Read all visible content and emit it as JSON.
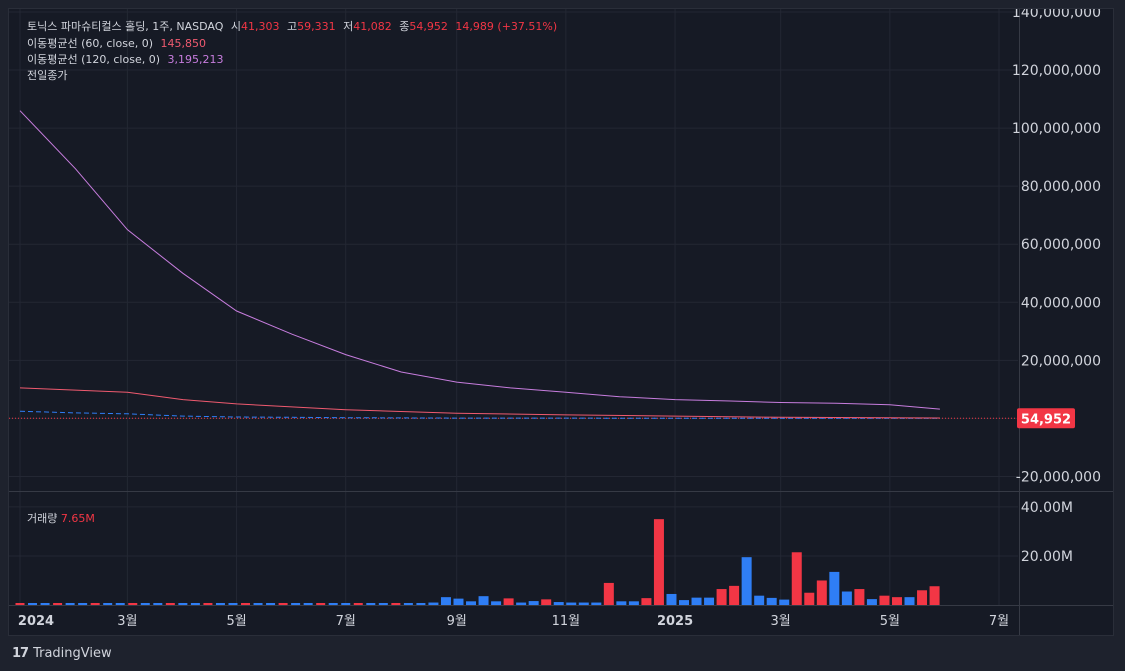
{
  "header": {
    "symbol": "토닉스 파마슈티컬스 홀딩, 1주, NASDAQ",
    "open_label": "시",
    "open": "41,303",
    "high_label": "고",
    "high": "59,331",
    "low_label": "저",
    "low": "41,082",
    "close_label": "종",
    "close": "54,952",
    "change": "14,989 (+37.51%)"
  },
  "indicators": [
    {
      "label": "이동평균선 (60, close, 0)",
      "value": "145,850",
      "color": "#ef5a6f"
    },
    {
      "label": "이동평균선 (120, close, 0)",
      "value": "3,195,213",
      "color": "#c77dde"
    },
    {
      "label": "전일종가",
      "value": ""
    }
  ],
  "volume_legend": {
    "label": "거래량",
    "value": "7.65M"
  },
  "last_price_tag": "54,952",
  "brand": "TradingView",
  "colors": {
    "up": "#f23645",
    "down": "#2f7ef5",
    "ma60": "#ef5a6f",
    "ma120": "#c77dde",
    "background": "#161a25"
  },
  "chart_data": [
    {
      "type": "line",
      "title": "토닉스 파마슈티컬스 홀딩, 1주, NASDAQ",
      "ylim": [
        -25000000,
        140000000
      ],
      "y_ticks": [
        "140,000,000",
        "120,000,000",
        "100,000,000",
        "80,000,000",
        "60,000,000",
        "40,000,000",
        "20,000,000",
        "0",
        "-20,000,000"
      ],
      "x_ticks": [
        "2024",
        "3월",
        "5월",
        "7월",
        "9월",
        "11월",
        "2025",
        "3월",
        "5월",
        "7월"
      ],
      "grid": true,
      "series": [
        {
          "name": "이동평균선 (120, close, 0)",
          "x": [
            "2024-01-01",
            "2024-02-01",
            "2024-03-01",
            "2024-04-01",
            "2024-05-01",
            "2024-06-01",
            "2024-07-01",
            "2024-08-01",
            "2024-09-01",
            "2024-10-01",
            "2024-11-01",
            "2024-12-01",
            "2025-01-01",
            "2025-02-01",
            "2025-03-01",
            "2025-04-01",
            "2025-05-01",
            "2025-05-29"
          ],
          "values": [
            106000000,
            86000000,
            65000000,
            50000000,
            37000000,
            29000000,
            22000000,
            16000000,
            12500000,
            10500000,
            9000000,
            7500000,
            6500000,
            6000000,
            5500000,
            5200000,
            4700000,
            3200000
          ]
        },
        {
          "name": "이동평균선 (60, close, 0)",
          "x": [
            "2024-01-01",
            "2024-03-01",
            "2024-04-01",
            "2024-05-01",
            "2024-07-01",
            "2024-09-01",
            "2024-11-01",
            "2025-01-01",
            "2025-03-01",
            "2025-05-29"
          ],
          "values": [
            10500000,
            9000000,
            6500000,
            5000000,
            3000000,
            1800000,
            1200000,
            800000,
            400000,
            145850
          ]
        },
        {
          "name": "종가",
          "x": [
            "2024-01-01",
            "2024-02-01",
            "2024-03-01",
            "2024-04-01",
            "2024-05-01",
            "2024-06-01",
            "2024-07-01",
            "2024-09-01",
            "2024-12-01",
            "2025-05-29"
          ],
          "values": [
            2500000,
            1900000,
            1600000,
            800000,
            500000,
            400000,
            250000,
            120000,
            80000,
            54952
          ]
        }
      ],
      "last_value": 54952
    },
    {
      "type": "bar",
      "title": "거래량",
      "ylim": [
        0,
        42000000
      ],
      "y_ticks": [
        "40.00M",
        "20.00M"
      ],
      "series": [
        {
          "name": "거래량",
          "x": [
            "2024-08-19",
            "2024-08-26",
            "2024-09-02",
            "2024-09-09",
            "2024-09-16",
            "2024-09-23",
            "2024-09-30",
            "2024-10-07",
            "2024-10-14",
            "2024-10-21",
            "2024-10-28",
            "2024-11-04",
            "2024-11-11",
            "2024-11-18",
            "2024-11-25",
            "2024-12-02",
            "2024-12-09",
            "2024-12-16",
            "2024-12-23",
            "2024-12-30",
            "2025-01-06",
            "2025-01-13",
            "2025-01-20",
            "2025-01-27",
            "2025-02-03",
            "2025-02-10",
            "2025-02-17",
            "2025-02-24",
            "2025-03-03",
            "2025-03-10",
            "2025-03-17",
            "2025-03-24",
            "2025-03-31",
            "2025-04-07",
            "2025-04-14",
            "2025-04-21",
            "2025-04-28",
            "2025-05-05",
            "2025-05-12",
            "2025-05-19",
            "2025-05-26"
          ],
          "values": [
            1000000,
            3200000,
            2600000,
            1500000,
            3600000,
            1500000,
            2700000,
            1000000,
            1600000,
            2300000,
            1200000,
            1000000,
            1000000,
            1000000,
            9000000,
            1500000,
            1500000,
            2800000,
            35000000,
            4500000,
            2000000,
            3000000,
            3000000,
            6500000,
            7800000,
            19500000,
            3800000,
            2900000,
            2200000,
            21500000,
            5000000,
            10000000,
            13500000,
            5500000,
            6500000,
            2400000,
            3800000,
            3200000,
            3200000,
            6000000,
            7650000
          ],
          "direction": [
            "down",
            "down",
            "down",
            "down",
            "down",
            "down",
            "up",
            "down",
            "down",
            "up",
            "down",
            "down",
            "down",
            "down",
            "up",
            "down",
            "down",
            "up",
            "up",
            "down",
            "down",
            "down",
            "down",
            "up",
            "up",
            "down",
            "down",
            "down",
            "down",
            "up",
            "up",
            "up",
            "down",
            "down",
            "up",
            "down",
            "up",
            "up",
            "down",
            "up",
            "up"
          ]
        }
      ]
    }
  ]
}
